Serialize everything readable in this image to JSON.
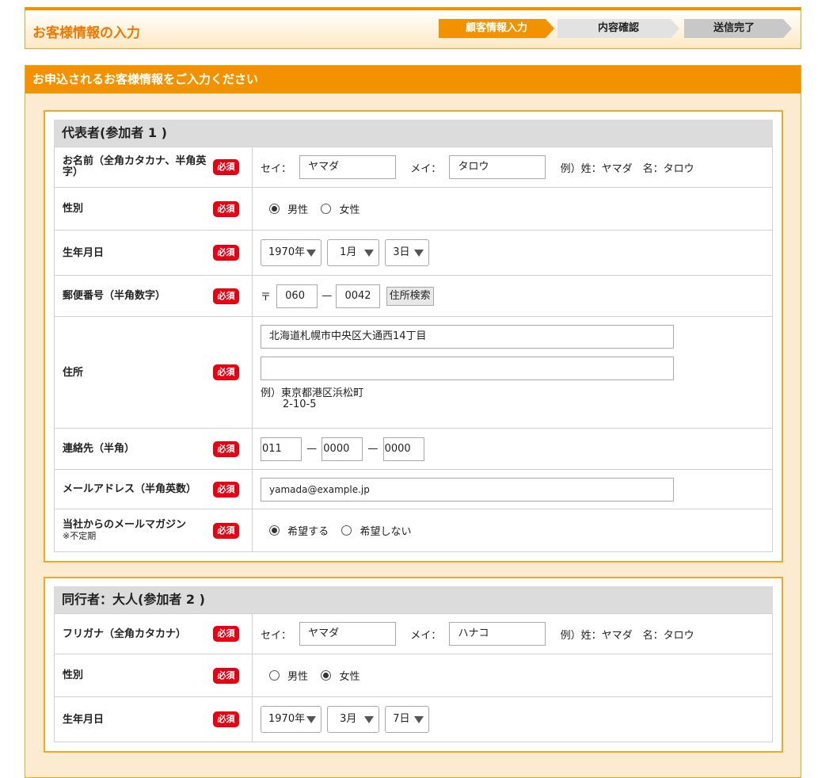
{
  "header": {
    "title": "お客様情報の入力",
    "steps": [
      "顧客情報入力",
      "内容確認",
      "送信完了"
    ]
  },
  "section_title": "お申込されるお客様情報をご入力ください",
  "required_badge": "必須",
  "participant1": {
    "title": "代表者(参加者 1 )",
    "name_label": "お名前（全角カタカナ、半角英字）",
    "sei_label": "セイ：",
    "sei_value": "ヤマダ",
    "mei_label": "メイ：",
    "mei_value": "タロウ",
    "name_example": "例）姓：ヤマダ　名：タロウ",
    "gender_label": "性別",
    "gender_male": "男性",
    "gender_female": "女性",
    "gender_selected": "male",
    "birth_label": "生年月日",
    "birth_year": "1970年",
    "birth_month": "1月",
    "birth_day": "3日",
    "zip_label": "郵便番号（半角数字）",
    "zip_mark": "〒",
    "zip1": "060",
    "zip_dash": "—",
    "zip2": "0042",
    "zip_search": "住所検索",
    "address_label": "住所",
    "address1": "北海道札幌市中央区大通西14丁目",
    "address2": "",
    "address_example_line1": "例）東京都港区浜松町",
    "address_example_line2": "2-10-5",
    "phone_label": "連絡先（半角）",
    "phone1": "011",
    "phone2": "0000",
    "phone3": "0000",
    "phone_dash": "—",
    "email_label": "メールアドレス（半角英数）",
    "email_value": "yamada@example.jp",
    "mag_label": "当社からのメールマガジン",
    "mag_note": "※不定期",
    "mag_yes": "希望する",
    "mag_no": "希望しない",
    "mag_selected": "yes"
  },
  "participant2": {
    "title": "同行者：大人(参加者 2 )",
    "name_label": "フリガナ（全角カタカナ）",
    "sei_label": "セイ：",
    "sei_value": "ヤマダ",
    "mei_label": "メイ：",
    "mei_value": "ハナコ",
    "name_example": "例）姓：ヤマダ　名：タロウ",
    "gender_label": "性別",
    "gender_male": "男性",
    "gender_female": "女性",
    "gender_selected": "female",
    "birth_label": "生年月日",
    "birth_year": "1970年",
    "birth_month": "3月",
    "birth_day": "7日"
  }
}
